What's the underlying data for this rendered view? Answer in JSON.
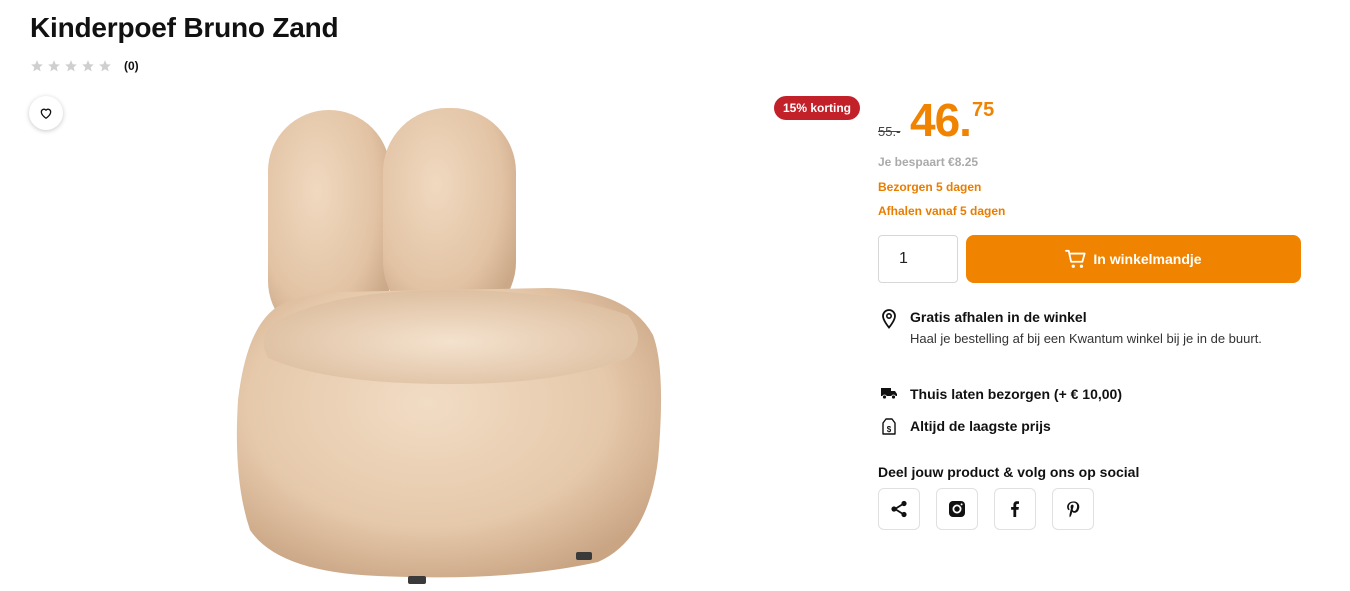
{
  "product": {
    "title": "Kinderpoef Bruno Zand",
    "rating": {
      "stars": 0,
      "max_stars": 5,
      "count_label": "(0)"
    }
  },
  "pricing": {
    "discount_badge": "15% korting",
    "old_price": "55.-",
    "price_main": "46.",
    "price_decimals": "75",
    "savings": "Je bespaart €8.25",
    "delivery": "Bezorgen 5 dagen",
    "pickup": "Afhalen vanaf 5 dagen"
  },
  "cart": {
    "quantity": "1",
    "button_label": "In winkelmandje"
  },
  "usps": [
    {
      "icon": "location-pin-icon",
      "title": "Gratis afhalen in de winkel",
      "description": "Haal je bestelling af bij een Kwantum winkel bij je in de buurt."
    },
    {
      "icon": "truck-icon",
      "title": "Thuis laten bezorgen (+ € 10,00)"
    },
    {
      "icon": "price-tag-icon",
      "title": "Altijd de laagste prijs"
    }
  ],
  "social": {
    "title": "Deel jouw product & volg ons op social",
    "buttons": [
      "share-icon",
      "instagram-icon",
      "facebook-icon",
      "pinterest-icon"
    ]
  },
  "colors": {
    "accent": "#f08300",
    "badge": "#c3212a",
    "muted": "#aaaaaa"
  }
}
